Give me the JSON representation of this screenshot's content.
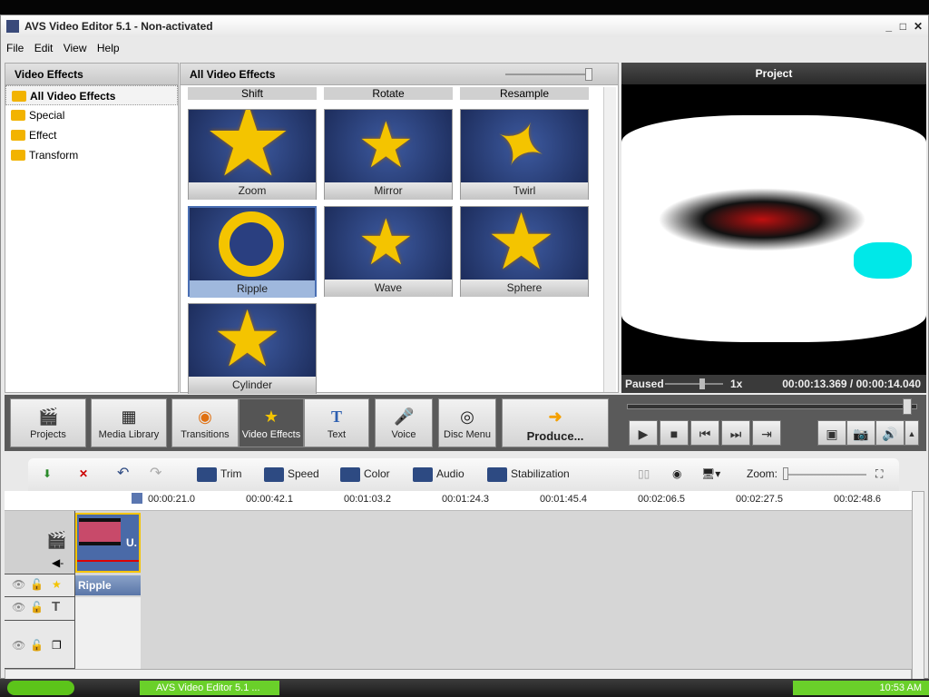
{
  "window": {
    "title": "AVS Video Editor 5.1 - Non-activated"
  },
  "menu": [
    "File",
    "Edit",
    "View",
    "Help"
  ],
  "left_panel": {
    "title": "Video Effects",
    "items": [
      "All Video Effects",
      "Special",
      "Effect",
      "Transform"
    ],
    "selected": 0
  },
  "effects_panel": {
    "title": "All Video Effects",
    "top_row": [
      "Shift",
      "Rotate",
      "Resample"
    ],
    "tiles": [
      "Zoom",
      "Mirror",
      "Twirl",
      "Ripple",
      "Wave",
      "Sphere",
      "Cylinder"
    ],
    "selected": "Ripple"
  },
  "preview": {
    "title": "Project",
    "status": "Paused",
    "speed": "1x",
    "time": "00:00:13.369 / 00:00:14.040",
    "position_fraction": 0.95
  },
  "tabs": [
    "Projects",
    "Media Library",
    "Transitions",
    "Video Effects",
    "Text",
    "Voice",
    "Disc Menu",
    "Produce..."
  ],
  "active_tab": "Video Effects",
  "timeline_toolbar": {
    "tools": [
      "Trim",
      "Speed",
      "Color",
      "Audio",
      "Stabilization"
    ],
    "zoom_label": "Zoom:"
  },
  "ruler": [
    "00:00:21.0",
    "00:00:42.1",
    "00:01:03.2",
    "00:01:24.3",
    "00:01:45.4",
    "00:02:06.5",
    "00:02:27.5",
    "00:02:48.6"
  ],
  "timeline": {
    "effect_clip": "Ripple",
    "video_clip_badge": "U."
  },
  "taskbar": {
    "app": "AVS Video Editor 5.1 ...",
    "clock": "10:53 AM"
  }
}
